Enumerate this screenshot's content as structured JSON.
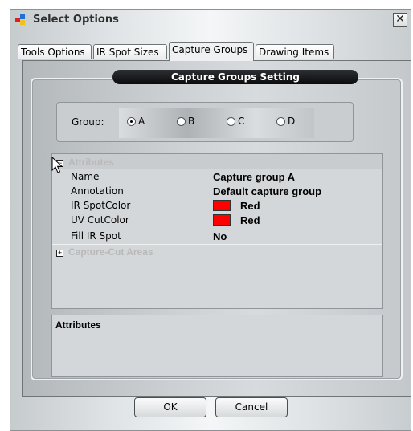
{
  "window": {
    "title": "Select Options",
    "close_glyph": "✕"
  },
  "tabs": [
    {
      "label": "Tools Options",
      "active": false
    },
    {
      "label": "IR Spot Sizes",
      "active": false
    },
    {
      "label": "Capture Groups",
      "active": true
    },
    {
      "label": "Drawing Items",
      "active": false
    }
  ],
  "groupbox": {
    "caption": "Capture Groups Setting"
  },
  "group": {
    "label": "Group:",
    "options": [
      {
        "label": "A",
        "selected": true
      },
      {
        "label": "B",
        "selected": false
      },
      {
        "label": "C",
        "selected": false
      },
      {
        "label": "D",
        "selected": false
      }
    ]
  },
  "property_grid": {
    "attributes_category": {
      "label": "Attributes",
      "expander": "−"
    },
    "properties": [
      {
        "name": "Name",
        "value": "Capture group A"
      },
      {
        "name": "Annotation",
        "value": "Default capture group"
      },
      {
        "name": "IR SpotColor",
        "value": "Red",
        "swatch": "#ff0000"
      },
      {
        "name": "UV CutColor",
        "value": "Red",
        "swatch": "#ff0000"
      },
      {
        "name": "Fill IR Spot",
        "value": "No"
      }
    ],
    "cut_areas_category": {
      "label": "Capture-Cut Areas",
      "expander": "+"
    }
  },
  "description": {
    "title": "Attributes"
  },
  "buttons": {
    "ok": "OK",
    "cancel": "Cancel"
  },
  "icons": {
    "app": "app-icon",
    "cursor": "mouse-pointer-icon"
  }
}
